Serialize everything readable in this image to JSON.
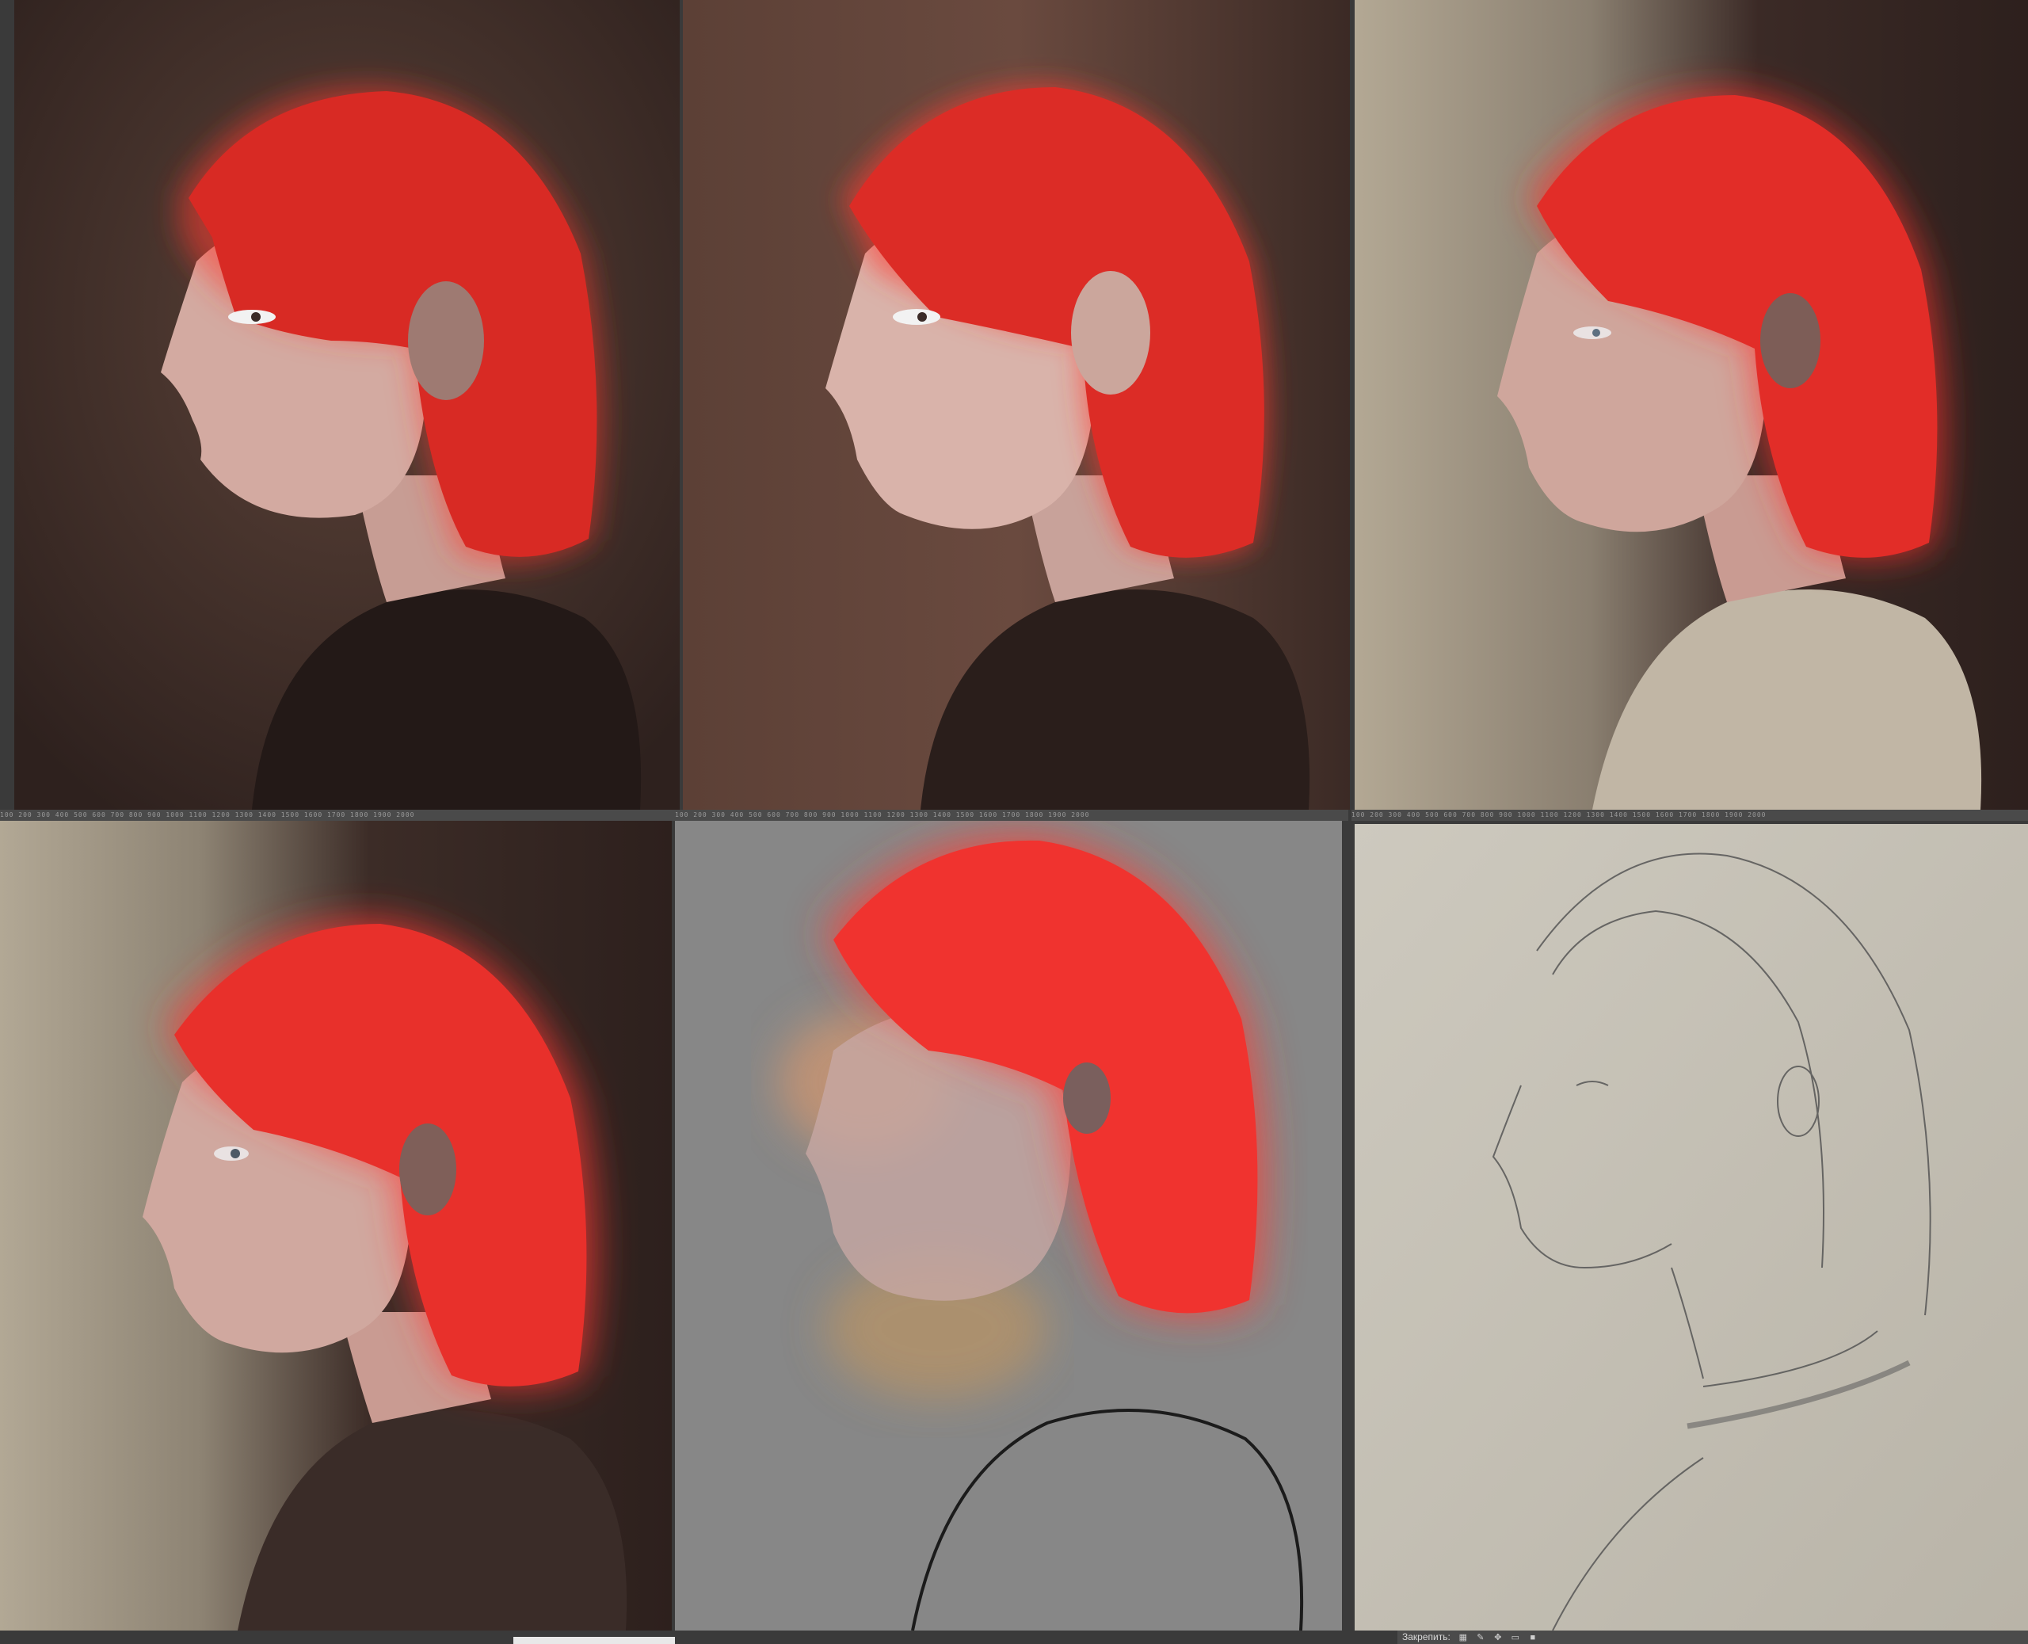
{
  "panels": [
    {
      "id": "painting-stage-1",
      "label": "painting stage 1"
    },
    {
      "id": "painting-stage-2",
      "label": "painting stage 2"
    },
    {
      "id": "painting-stage-3",
      "label": "painting stage 3"
    },
    {
      "id": "painting-stage-4",
      "label": "painting stage 4"
    },
    {
      "id": "painting-stage-5",
      "label": "painting stage 5"
    },
    {
      "id": "pencil-sketch",
      "label": "pencil sketch"
    }
  ],
  "ruler_ticks": "100  200  300  400  500  600  700  800  900  1000  1100  1200  1300  1400  1500  1600  1700  1800  1900  2000",
  "statusbar": {
    "lock_label": "Закрепить:",
    "tool_icons": [
      "lock-pixels-icon",
      "brush-icon",
      "move-icon",
      "artboard-icon",
      "lock-all-icon"
    ]
  },
  "colors": {
    "hair_red": "#e8322c",
    "skin": "#d9b0a6",
    "background_brown": "#3a2a26",
    "canvas_gray": "#878787",
    "paper": "#c8c4b8"
  }
}
